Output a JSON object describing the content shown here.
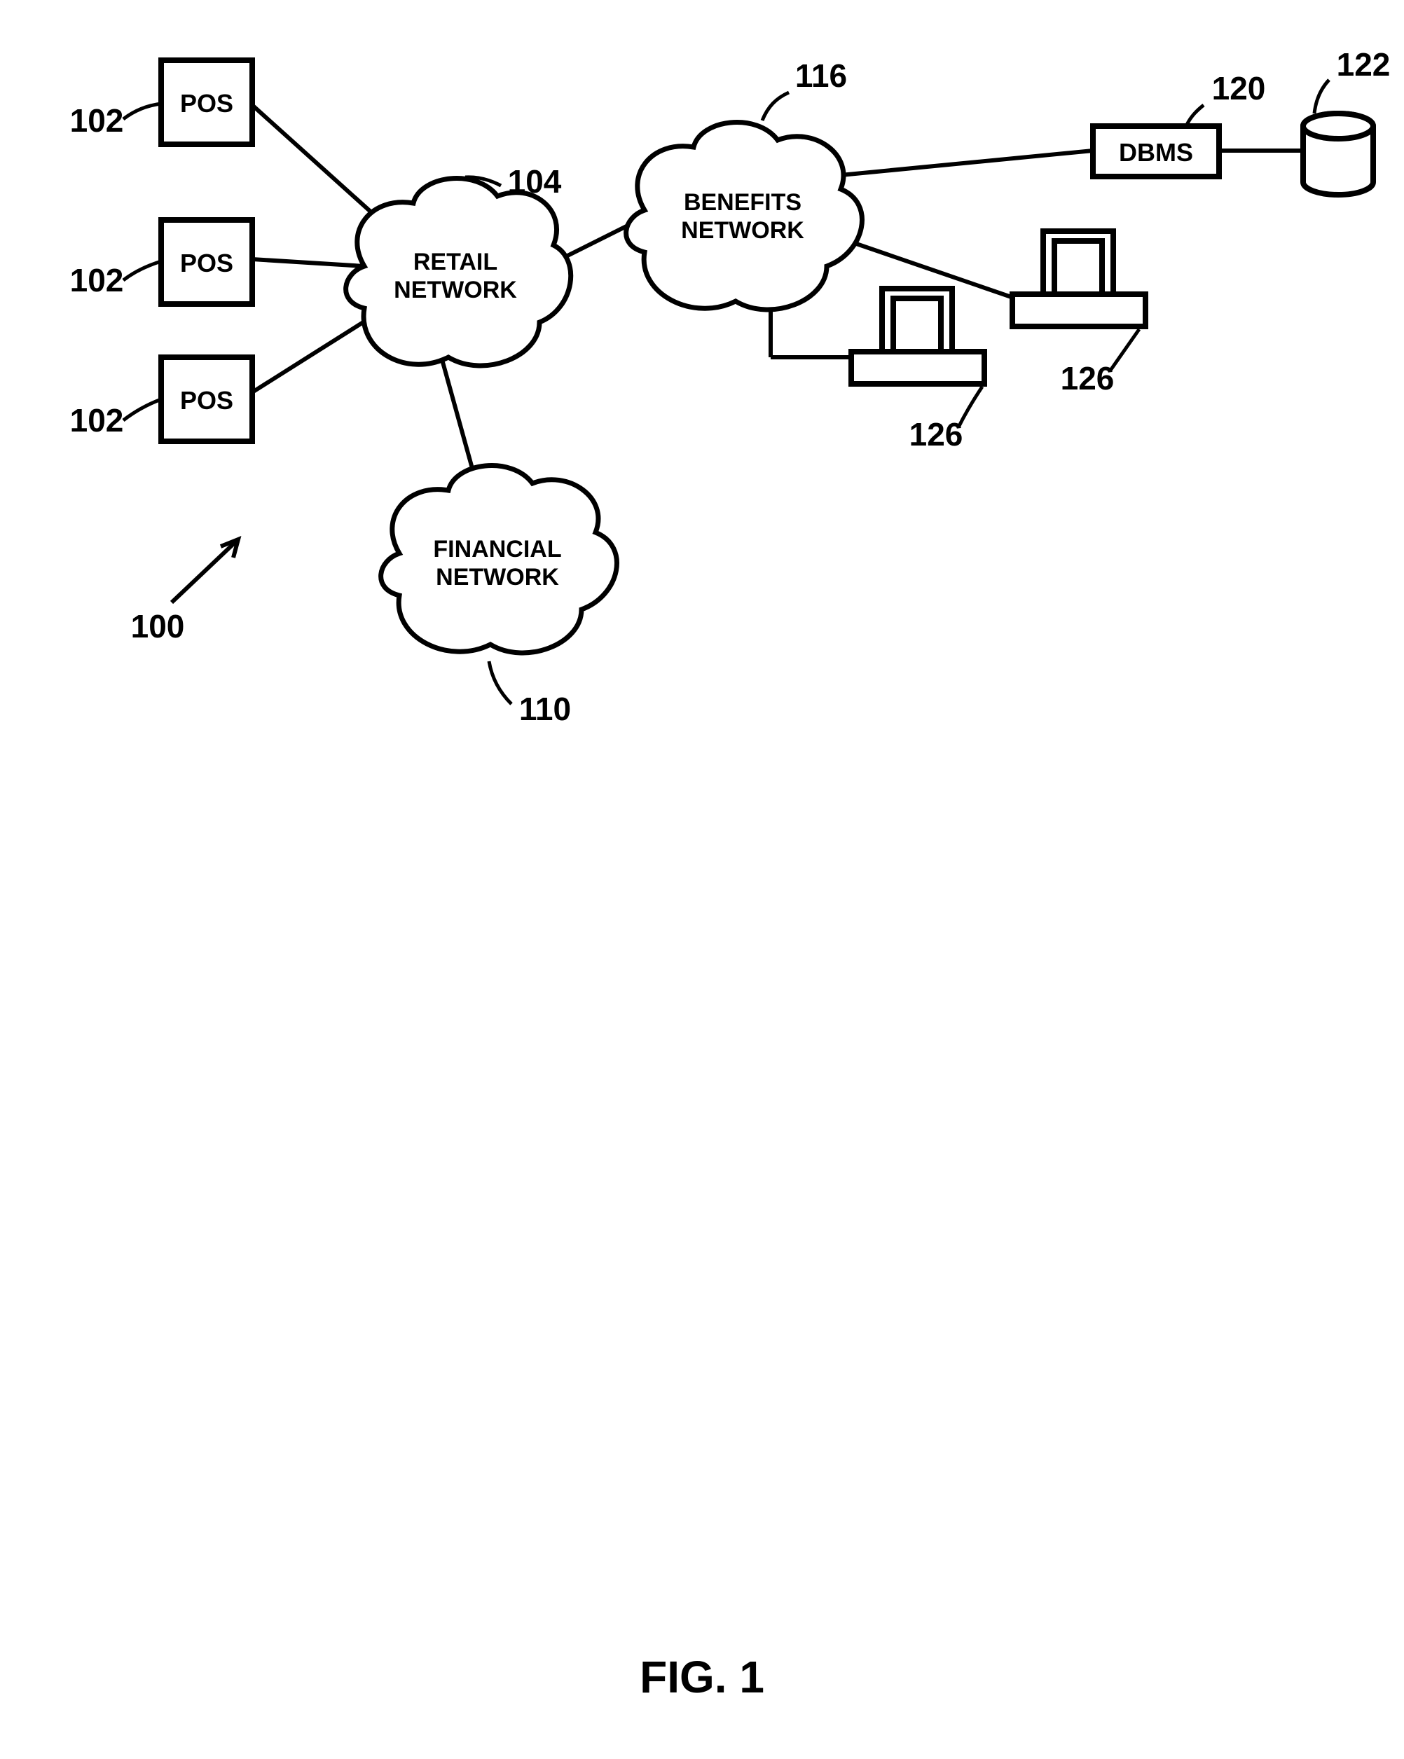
{
  "figure_caption": "FIG. 1",
  "labels": {
    "pos": "POS",
    "retail": "RETAIL NETWORK",
    "financial": "FINANCIAL NETWORK",
    "benefits": "BENEFITS NETWORK",
    "dbms": "DBMS"
  },
  "refs": {
    "diagram": "100",
    "pos": "102",
    "retail": "104",
    "financial": "110",
    "benefits": "116",
    "dbms": "120",
    "db": "122",
    "terminal": "126"
  }
}
